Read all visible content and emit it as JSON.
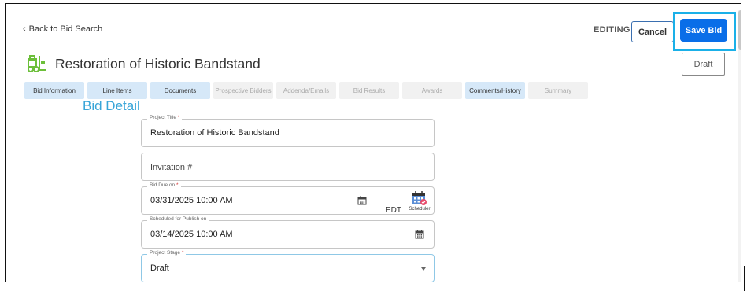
{
  "header": {
    "back_label": "Back to Bid Search",
    "mode_label": "EDITING",
    "cancel_label": "Cancel",
    "save_label": "Save Bid",
    "status_badge": "Draft"
  },
  "page": {
    "title": "Restoration of Historic Bandstand"
  },
  "tabs": [
    {
      "label": "Bid Information",
      "active": true
    },
    {
      "label": "Line Items",
      "active": true
    },
    {
      "label": "Documents",
      "active": true
    },
    {
      "label": "Prospective Bidders",
      "active": false
    },
    {
      "label": "Addenda/Emails",
      "active": false
    },
    {
      "label": "Bid Results",
      "active": false
    },
    {
      "label": "Awards",
      "active": false
    },
    {
      "label": "Comments/History",
      "active": true
    },
    {
      "label": "Summary",
      "active": false
    }
  ],
  "section": {
    "heading": "Bid Detail"
  },
  "form": {
    "project_title": {
      "label": "Project Title",
      "value": "Restoration of Historic Bandstand"
    },
    "invitation": {
      "placeholder": "Invitation #"
    },
    "bid_due": {
      "label": "Bid Due on",
      "value": "03/31/2025 10:00 AM",
      "timezone": "EDT"
    },
    "publish": {
      "label": "Scheduled for Publish on",
      "value": "03/14/2025 10:00 AM"
    },
    "stage": {
      "label": "Project Stage",
      "value": "Draft"
    },
    "required_mark": "*"
  },
  "scheduler": {
    "label": "Scheduler"
  },
  "colors": {
    "accent": "#0a6ee8",
    "highlight": "#1ab0e8",
    "heading": "#38a5d8",
    "tab_active": "#d6e8f8"
  }
}
